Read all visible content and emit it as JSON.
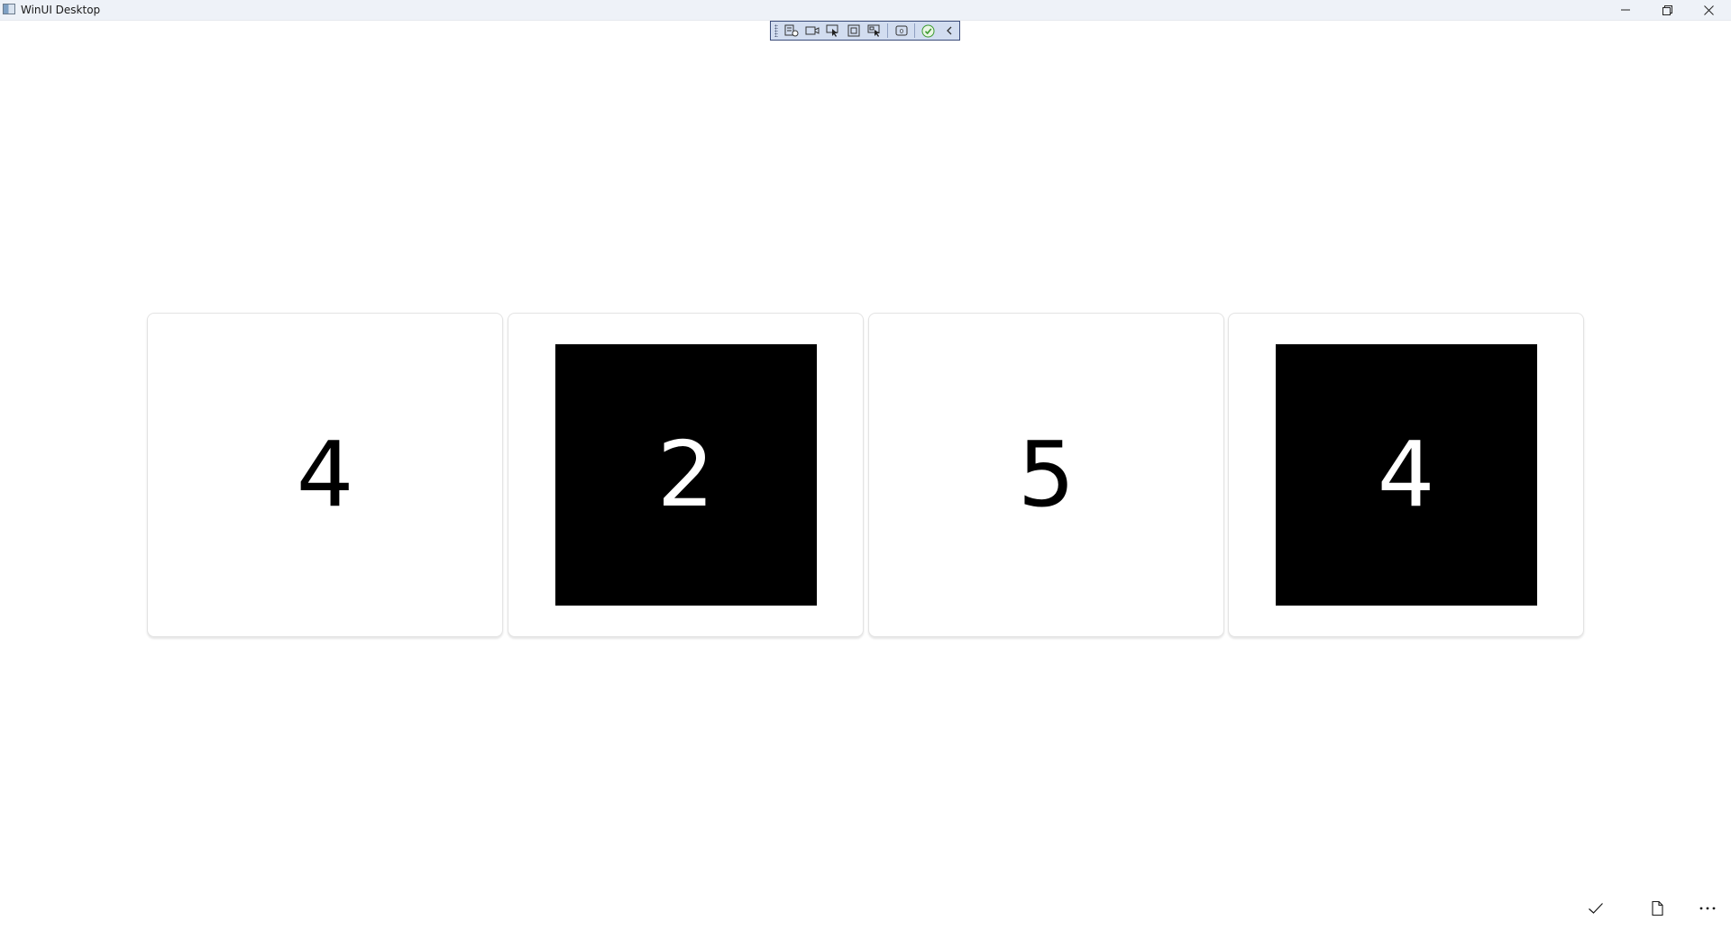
{
  "window": {
    "title": "WinUI Desktop"
  },
  "cards": [
    {
      "value": "4",
      "style": "light"
    },
    {
      "value": "2",
      "style": "dark"
    },
    {
      "value": "5",
      "style": "light"
    },
    {
      "value": "4",
      "style": "dark"
    }
  ],
  "colors": {
    "dark_face": "#000000",
    "light_face": "#ffffff",
    "titlebar": "#eef2f8",
    "debug_toolbar": "#d2ddf0"
  },
  "icons": {
    "window": [
      "app-icon",
      "minimize-icon",
      "restore-icon",
      "close-icon"
    ],
    "debug_toolbar": [
      "live-visual-tree-icon",
      "record-icon",
      "select-element-icon",
      "display-layout-adorners-icon",
      "track-focus-icon",
      "binding-failures-icon",
      "hot-reload-status-icon",
      "collapse-chevron-icon"
    ],
    "command_bar": [
      "checkmark-icon",
      "page-icon",
      "more-icon"
    ]
  }
}
